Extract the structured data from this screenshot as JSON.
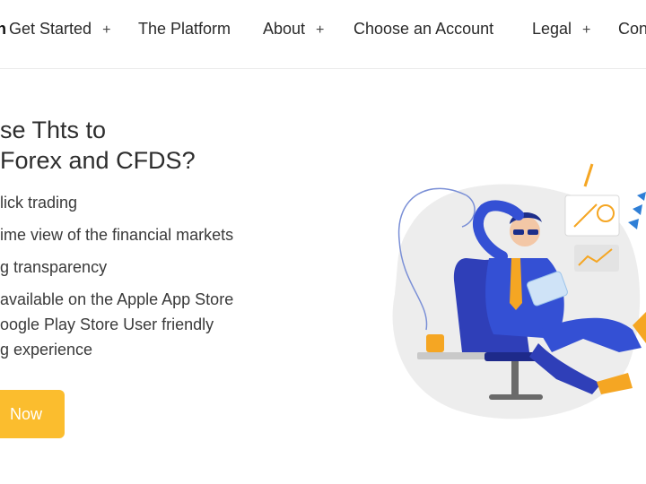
{
  "nav": {
    "logo_fragment": "n",
    "items": [
      {
        "label": "Get Started",
        "has_plus": true
      },
      {
        "label": "The Platform",
        "has_plus": false
      },
      {
        "label": "About",
        "has_plus": true
      },
      {
        "label": "Choose an Account",
        "has_plus": false
      },
      {
        "label": "Legal",
        "has_plus": true
      },
      {
        "label": "Con",
        "has_plus": false
      }
    ],
    "plus_symbol": "+"
  },
  "hero": {
    "heading_line1": "se Thts to",
    "heading_line2": "Forex and CFDS?",
    "features": [
      "lick trading",
      "ime view of the financial markets",
      "g transparency",
      "available on the Apple App Store",
      "oogle Play Store User friendly",
      "g experience"
    ],
    "cta_label": "Now"
  },
  "colors": {
    "accent": "#fbbd2e",
    "text": "#2a2a2a",
    "illustration_blue": "#2f3fb8",
    "illustration_orange": "#f5a623"
  }
}
